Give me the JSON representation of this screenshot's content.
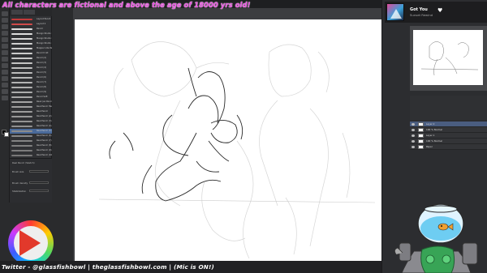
{
  "overlay": {
    "top_text": "All characters are fictional and above the age of 18000 yrs old!",
    "bottom_text": "Twitter - @glassfishbowl | theglassfishbowl.com | (Mic is ON!)"
  },
  "now_playing": {
    "title": "Got You",
    "artist": "Sunset Rewind",
    "heart_icon": "heart-icon"
  },
  "colors": {
    "overlay_text": "#e94ee0",
    "canvas": "#ffffff",
    "selection": "#4a6a9a",
    "play_button": "#e2392b"
  },
  "brushes": [
    {
      "name": "Layout Pencil",
      "color": "#c33a3a"
    },
    {
      "name": "Layout 2",
      "color": "#d04a4a"
    },
    {
      "name": "Pencil",
      "color": "#e0e0e0"
    },
    {
      "name": "Mango Studio 1 Pencil",
      "color": "#dddddd"
    },
    {
      "name": "Mango Studio 2 Pencil",
      "color": "#d8d8d8"
    },
    {
      "name": "Mango Studio 3 Pencil",
      "color": "#d0d0d0"
    },
    {
      "name": "Mapper Lite Pen",
      "color": "#cfcfcf"
    },
    {
      "name": "Pencil 0 Alt",
      "color": "#cccccc"
    },
    {
      "name": "Pencil (2)",
      "color": "#c8c8c8"
    },
    {
      "name": "Pencil (3)",
      "color": "#c4c4c4"
    },
    {
      "name": "Pencil (4)",
      "color": "#c0c0c0"
    },
    {
      "name": "Pencil (5)",
      "color": "#bcbcbc"
    },
    {
      "name": "Pencil (6)",
      "color": "#b8b8b8"
    },
    {
      "name": "Pencil (7)",
      "color": "#b4b4b4"
    },
    {
      "name": "Pencil (8)",
      "color": "#b0b0b0"
    },
    {
      "name": "Pencil (9)",
      "color": "#acacac"
    },
    {
      "name": "Pencil Soft",
      "color": "#a8a8a8"
    },
    {
      "name": "Reaz (ex Pencil) Sketch",
      "color": "#a4a4a4"
    },
    {
      "name": "Real Pencil Hard",
      "color": "#a0a0a0"
    },
    {
      "name": "Real Pencil",
      "color": "#9c9c9c"
    },
    {
      "name": "Real Pencil (2)",
      "color": "#989898"
    },
    {
      "name": "Real Pencil (3)",
      "color": "#949494"
    },
    {
      "name": "Real Pencil (4)",
      "color": "#909090"
    },
    {
      "name": "Real Pencil (5)",
      "color": "#8c8c8c"
    },
    {
      "name": "Real Pencil (6)",
      "color": "#888888"
    },
    {
      "name": "Real Pencil (7)",
      "color": "#848484"
    },
    {
      "name": "Real Pencil (8)",
      "color": "#808080"
    },
    {
      "name": "Real Pencil (9)",
      "color": "#7c7c7c"
    },
    {
      "name": "Real Pencil (10)",
      "color": "#787878"
    }
  ],
  "tool_properties": {
    "title": "Real Pencil (Sketch)",
    "items": [
      "Brush size",
      "Brush density",
      "Stabilization"
    ],
    "values": [
      "7.0",
      "100",
      "10"
    ]
  },
  "layers": [
    {
      "name": "Layer 2",
      "selected": true
    },
    {
      "name": "100 % Normal",
      "selected": false
    },
    {
      "name": "Layer 1",
      "selected": false
    },
    {
      "name": "100 % Normal",
      "selected": false
    },
    {
      "name": "Paper",
      "selected": false
    }
  ]
}
